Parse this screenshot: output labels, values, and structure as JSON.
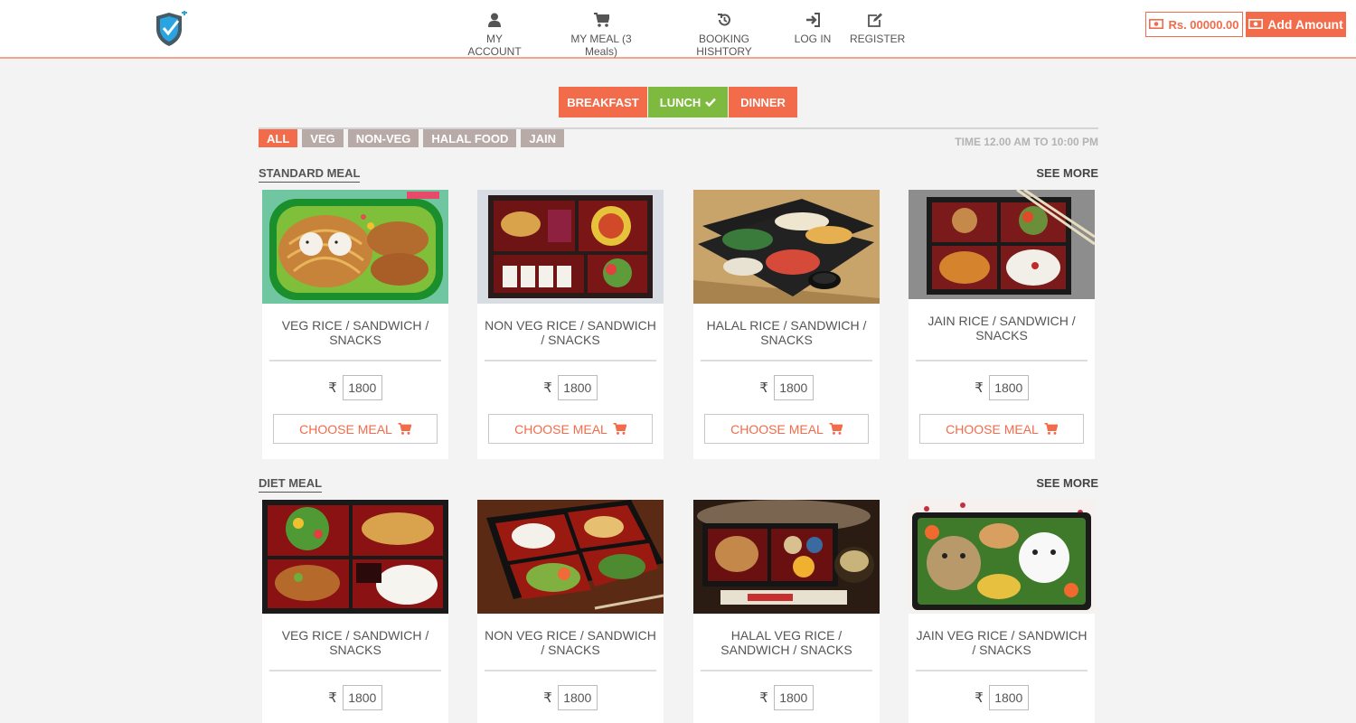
{
  "header": {
    "nav": [
      {
        "label": "MY ACCOUNT",
        "icon": "user-icon"
      },
      {
        "label": "MY MEAL (3 Meals)",
        "icon": "cart-icon"
      },
      {
        "label": "BOOKING HISHTORY",
        "icon": "history-icon"
      },
      {
        "label": "LOG IN",
        "icon": "login-icon"
      },
      {
        "label": "REGISTER",
        "icon": "edit-icon"
      }
    ],
    "wallet_balance": "Rs. 00000.00",
    "add_amount_label": "Add Amount"
  },
  "meal_tabs": [
    {
      "label": "BREAKFAST",
      "active": false
    },
    {
      "label": "LUNCH",
      "active": true
    },
    {
      "label": "DINNER",
      "active": false
    }
  ],
  "filters": [
    {
      "label": "ALL",
      "active": true
    },
    {
      "label": "VEG",
      "active": false
    },
    {
      "label": "NON-VEG",
      "active": false
    },
    {
      "label": "HALAL FOOD",
      "active": false
    },
    {
      "label": "JAIN",
      "active": false
    }
  ],
  "time_text": "TIME 12.00 AM TO 10:00 PM",
  "sections": [
    {
      "title": "STANDARD MEAL",
      "see_more": "SEE MORE",
      "items": [
        {
          "name": "VEG RICE / SANDWICH / SNACKS",
          "currency": "₹",
          "price": "1800",
          "button": "CHOOSE MEAL"
        },
        {
          "name": "NON VEG RICE / SANDWICH / SNACKS",
          "currency": "₹",
          "price": "1800",
          "button": "CHOOSE MEAL"
        },
        {
          "name": "HALAL RICE / SANDWICH / SNACKS",
          "currency": "₹",
          "price": "1800",
          "button": "CHOOSE MEAL"
        },
        {
          "name": "JAIN RICE / SANDWICH / SNACKS",
          "currency": "₹",
          "price": "1800",
          "button": "CHOOSE MEAL"
        }
      ]
    },
    {
      "title": "DIET MEAL",
      "see_more": "SEE MORE",
      "items": [
        {
          "name": "VEG RICE / SANDWICH / SNACKS",
          "currency": "₹",
          "price": "1800"
        },
        {
          "name": "NON VEG RICE / SANDWICH / SNACKS",
          "currency": "₹",
          "price": "1800"
        },
        {
          "name": "HALAL VEG RICE / SANDWICH / SNACKS",
          "currency": "₹",
          "price": "1800"
        },
        {
          "name": "JAIN VEG RICE / SANDWICH / SNACKS",
          "currency": "₹",
          "price": "1800"
        }
      ]
    }
  ],
  "colors": {
    "accent": "#f26b4b",
    "active_tab": "#7dba3f",
    "filter_inactive": "#b7aaa7",
    "background": "#f3f3f3"
  }
}
